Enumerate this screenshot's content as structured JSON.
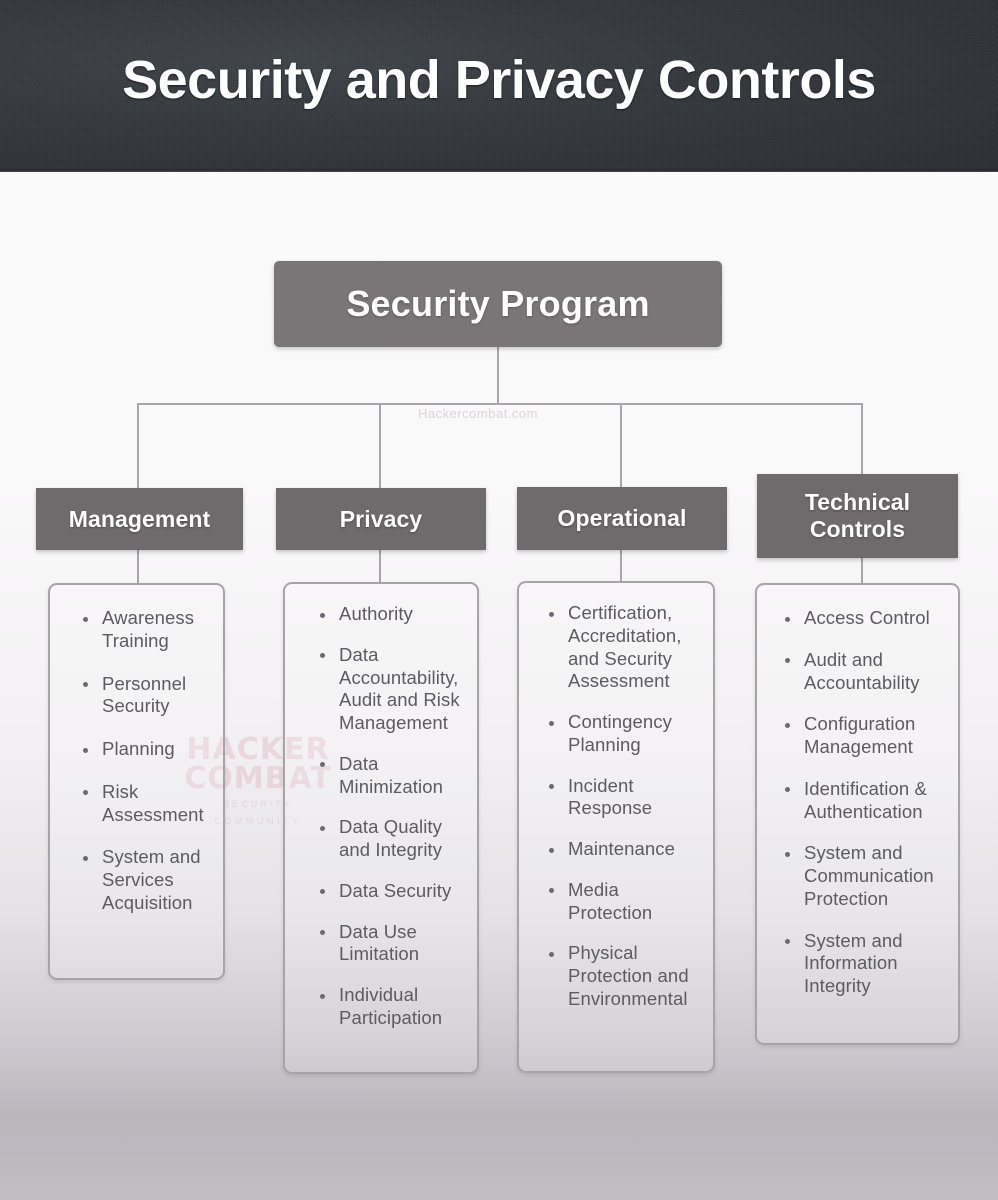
{
  "banner": {
    "title": "Security and Privacy Controls"
  },
  "watermarks": {
    "url": "Hackercombat.com",
    "logo_line1": "HACKER",
    "logo_line2": "COMBAT",
    "logo_line3": "SECURITY",
    "logo_line4": "COMMUNITY"
  },
  "colors": {
    "banner_bg": "#34383d",
    "root_box_bg": "#7a7678",
    "category_box_bg": "#6f6b6c",
    "panel_border": "#a7a4a9",
    "connector": "#a9a6ab",
    "text_light": "#ffffff",
    "text_body": "#5b5b60",
    "watermark_red": "#d6a0aa"
  },
  "chart_data": {
    "type": "tree",
    "title": "Security and Privacy Controls",
    "root": "Security Program",
    "branches": [
      {
        "label": "Management",
        "items": [
          "Awareness Training",
          "Personnel Security",
          "Planning",
          "Risk Assessment",
          "System and Services Acquisition"
        ]
      },
      {
        "label": "Privacy",
        "items": [
          "Authority",
          "Data Accountability, Audit and Risk Management",
          "Data Minimization",
          "Data Quality and Integrity",
          "Data Security",
          "Data Use Limitation",
          "Individual Participation"
        ]
      },
      {
        "label": "Operational",
        "items": [
          "Certification, Accreditation, and Security Assessment",
          "Contingency Planning",
          "Incident Response",
          "Maintenance",
          "Media Protection",
          "Physical Protection and Environmental"
        ]
      },
      {
        "label": "Technical Controls",
        "items": [
          "Access Control",
          "Audit and Accountability",
          "Configuration Management",
          "Identification & Authentication",
          "System and Communication Protection",
          "System and Information Integrity"
        ]
      }
    ]
  },
  "diagram": {
    "root_label": "Security Program",
    "columns": [
      {
        "header": "Management",
        "items": [
          "Awareness\nTraining",
          "Personnel\nSecurity",
          "Planning",
          "Risk\nAssessment",
          "System and\nServices\nAcquisition"
        ]
      },
      {
        "header": "Privacy",
        "items": [
          "Authority",
          "Data\nAccountability,\nAudit and Risk\nManagement",
          "Data\nMinimization",
          "Data Quality\nand Integrity",
          "Data Security",
          "Data Use\nLimitation",
          "Individual\nParticipation"
        ]
      },
      {
        "header": "Operational",
        "items": [
          "Certification,\nAccreditation,\nand Security\nAssessment",
          "Contingency\nPlanning",
          "Incident\nResponse",
          "Maintenance",
          "Media\nProtection",
          "Physical\nProtection and\nEnvironmental"
        ]
      },
      {
        "header": "Technical\nControls",
        "items": [
          "Access Control",
          "Audit and\nAccountability",
          "Configuration\nManagement",
          "Identification &\nAuthentication",
          "System and\nCommunication\nProtection",
          "System and\nInformation\nIntegrity"
        ]
      }
    ]
  }
}
